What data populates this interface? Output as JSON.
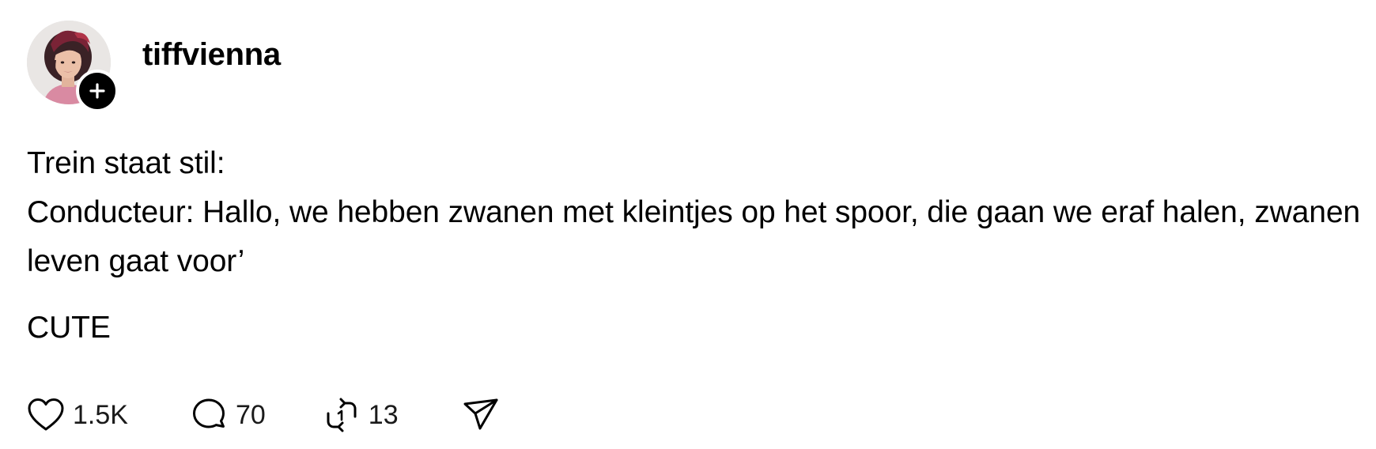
{
  "post": {
    "author": {
      "username": "tiffvienna",
      "avatar_icon": "profile-photo",
      "follow_icon": "plus-icon"
    },
    "text": {
      "line1": "Trein staat stil:",
      "line2": "Conducteur: Hallo, we hebben zwanen met kleintjes op het spoor, die gaan we eraf halen, zwanen leven gaat voor’",
      "line3": "CUTE"
    },
    "actions": {
      "like": {
        "icon": "heart-icon",
        "count": "1.5K"
      },
      "reply": {
        "icon": "speech-bubble-icon",
        "count": "70"
      },
      "repost": {
        "icon": "repost-icon",
        "count": "13"
      },
      "share": {
        "icon": "send-icon"
      }
    }
  },
  "colors": {
    "text": "#000000",
    "background": "#ffffff",
    "badge": "#000000"
  }
}
